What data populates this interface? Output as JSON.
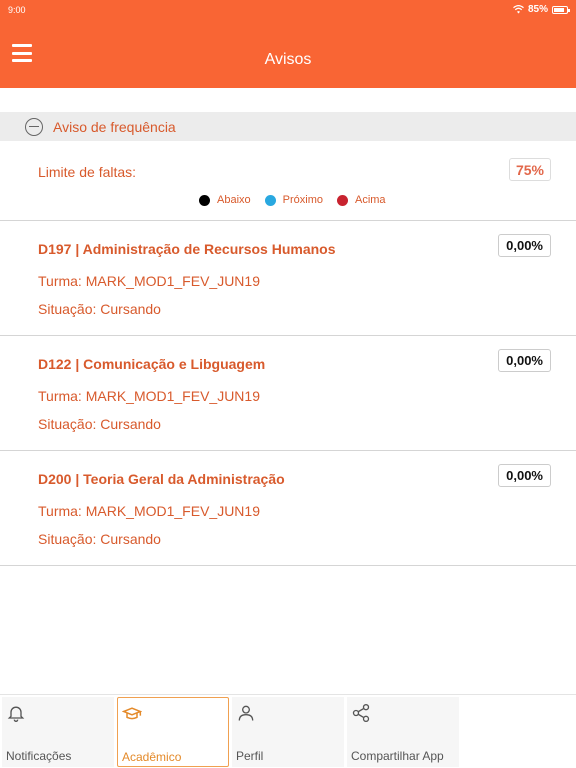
{
  "status_bar": {
    "time": "9:00",
    "battery": "85%",
    "battery_level": 0.85
  },
  "header": {
    "title": "Avisos"
  },
  "section": {
    "title": "Aviso de frequência"
  },
  "limit": {
    "label": "Limite de faltas:",
    "value": "75%"
  },
  "legend": [
    {
      "label": "Abaixo",
      "color": "#000000"
    },
    {
      "label": "Próximo",
      "color": "#29a8e0"
    },
    {
      "label": "Acima",
      "color": "#c8232f"
    }
  ],
  "courses": [
    {
      "name": "D197 | Administração de Recursos Humanos",
      "percent": "0,00%",
      "turma": "Turma: MARK_MOD1_FEV_JUN19",
      "situacao": "Situação: Cursando"
    },
    {
      "name": "D122 | Comunicação e Libguagem",
      "percent": "0,00%",
      "turma": "Turma: MARK_MOD1_FEV_JUN19",
      "situacao": "Situação: Cursando"
    },
    {
      "name": "D200 | Teoria Geral da Administração",
      "percent": "0,00%",
      "turma": "Turma: MARK_MOD1_FEV_JUN19",
      "situacao": "Situação: Cursando"
    }
  ],
  "tabs": [
    {
      "label": "Notificações",
      "icon": "bell-icon",
      "active": false
    },
    {
      "label": "Acadêmico",
      "icon": "graduation-cap-icon",
      "active": true
    },
    {
      "label": "Perfil",
      "icon": "person-icon",
      "active": false
    },
    {
      "label": "Compartilhar App",
      "icon": "share-icon",
      "active": false
    }
  ],
  "colors": {
    "brand": "#f96534",
    "text_accent": "#d85a2c",
    "active_tab": "#e48a2a"
  }
}
